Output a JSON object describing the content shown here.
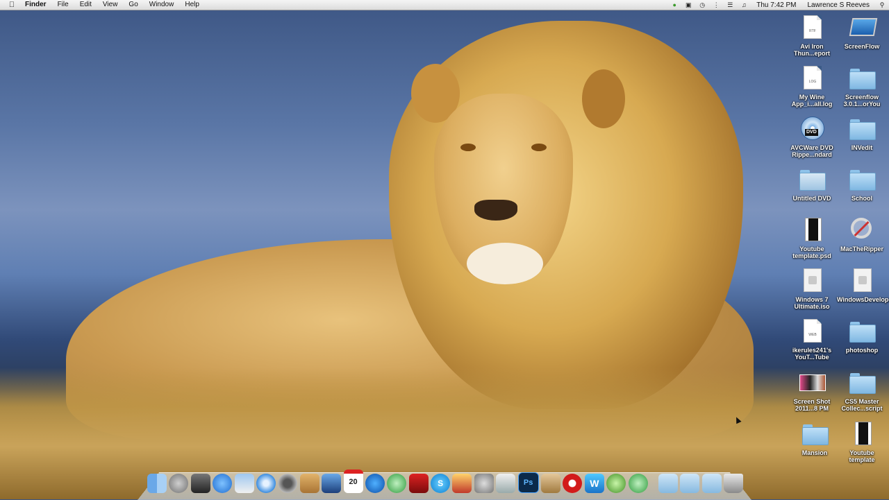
{
  "menubar": {
    "app_name": "Finder",
    "menus": [
      "File",
      "Edit",
      "View",
      "Go",
      "Window",
      "Help"
    ],
    "clock": "Thu 7:42 PM",
    "user": "Lawrence S Reeves"
  },
  "desktop_icons": [
    {
      "label": "Avi Iron Thun...eport",
      "ext": "RTF"
    },
    {
      "label": "ScreenFlow"
    },
    {
      "label": "My Wine App_i...all.log",
      "ext": "LOG"
    },
    {
      "label": "Screenflow 3.0.1...orYou"
    },
    {
      "label": "AVCWare DVD Rippe...ndard",
      "ext": "DVD"
    },
    {
      "label": "INVedit"
    },
    {
      "label": "Untitled DVD"
    },
    {
      "label": "School"
    },
    {
      "label": "Youtube template.psd"
    },
    {
      "label": "MacTheRipper"
    },
    {
      "label": "Windows 7 Ultimate.iso"
    },
    {
      "label": "WindowsDeveloper...sh.iso"
    },
    {
      "label": "ikerules241's YouT...Tube",
      "ext": "WEB"
    },
    {
      "label": "photoshop"
    },
    {
      "label": "Screen Shot 2011...8 PM"
    },
    {
      "label": "CS5 Master Collec...script"
    },
    {
      "label": "Mansion"
    },
    {
      "label": "Youtube template"
    }
  ],
  "dock": {
    "calendar_day": "20",
    "skype_letter": "S",
    "ps_letter": "Ps",
    "w_letter": "W"
  },
  "colors": {
    "folder": "#8ec3ea",
    "menubar": "#e8e8e8"
  }
}
